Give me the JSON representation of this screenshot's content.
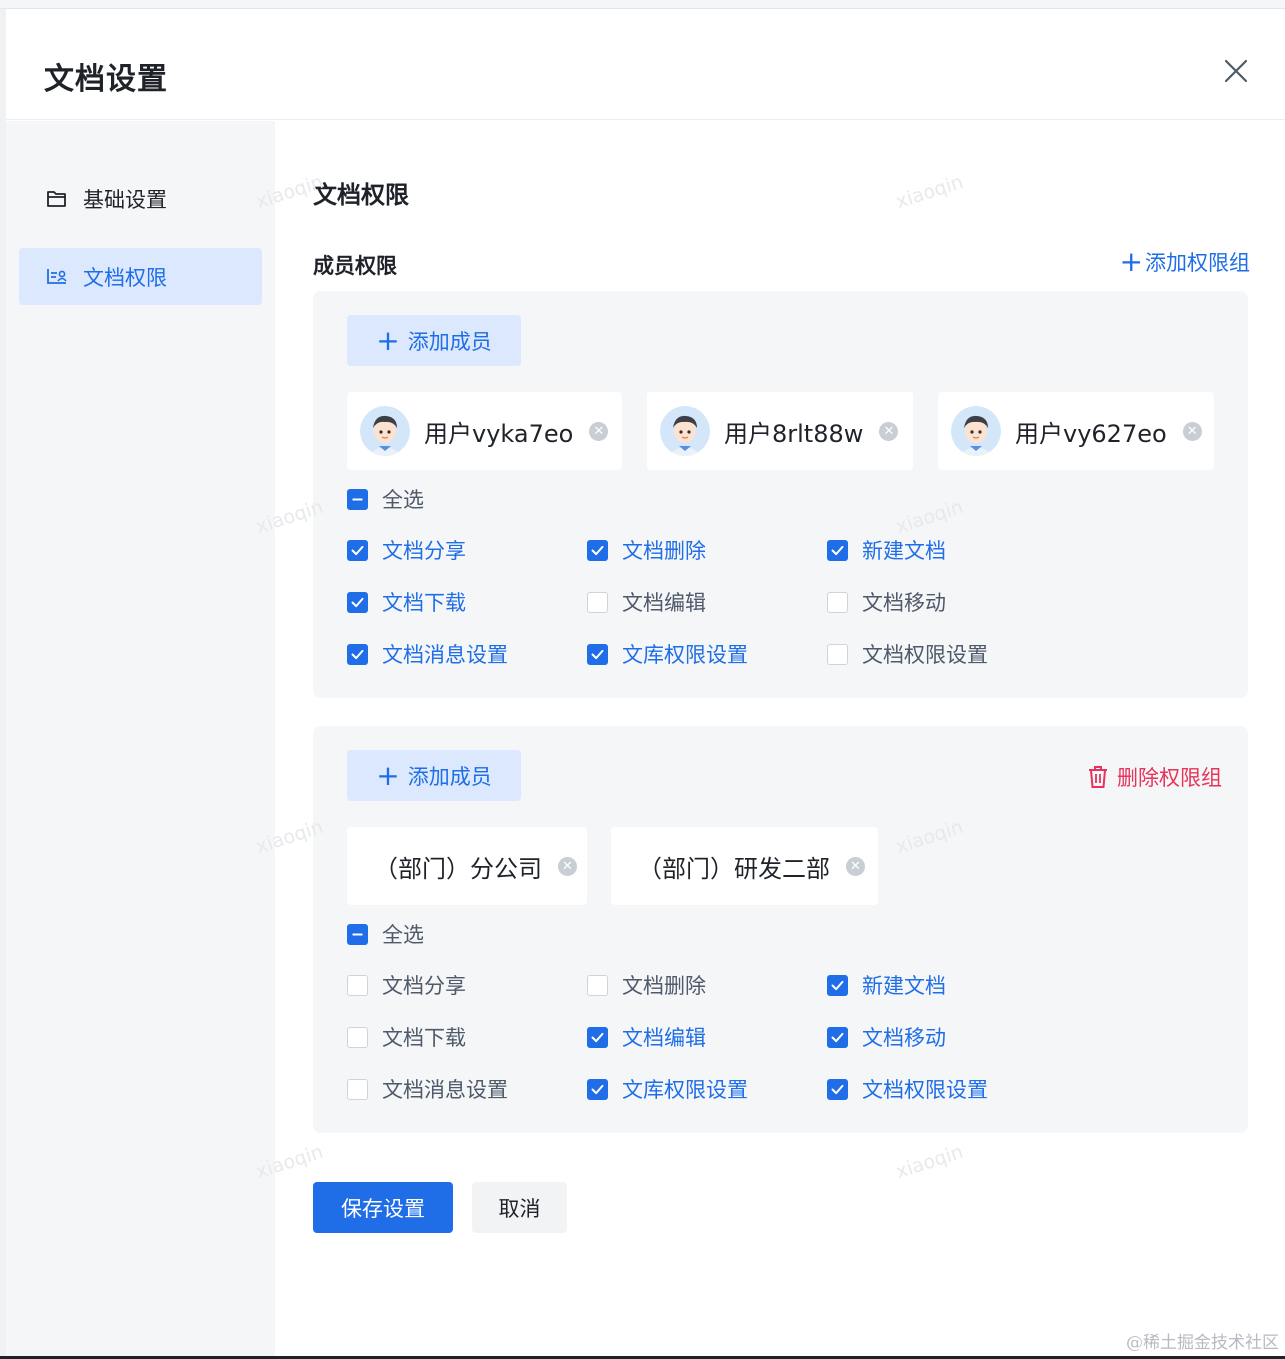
{
  "dialog": {
    "title": "文档设置",
    "close_icon": "close-icon"
  },
  "sidebar": {
    "items": [
      {
        "label": "基础设置",
        "icon": "folder-icon",
        "active": false
      },
      {
        "label": "文档权限",
        "icon": "permission-icon",
        "active": true
      }
    ]
  },
  "main": {
    "section_title": "文档权限",
    "sub_title": "成员权限",
    "add_group_label": "添加权限组",
    "groups": [
      {
        "add_member_label": "添加成员",
        "members": [
          {
            "name": "用户vyka7eo",
            "avatar": "user-avatar"
          },
          {
            "name": "用户8rlt88w",
            "avatar": "user-avatar"
          },
          {
            "name": "用户vy627eo",
            "avatar": "user-avatar"
          }
        ],
        "select_all_label": "全选",
        "select_all_state": "indeterminate",
        "permissions": [
          {
            "label": "文档分享",
            "checked": true
          },
          {
            "label": "文档删除",
            "checked": true
          },
          {
            "label": "新建文档",
            "checked": true
          },
          {
            "label": "文档下载",
            "checked": true
          },
          {
            "label": "文档编辑",
            "checked": false
          },
          {
            "label": "文档移动",
            "checked": false
          },
          {
            "label": "文档消息设置",
            "checked": true
          },
          {
            "label": "文库权限设置",
            "checked": true
          },
          {
            "label": "文档权限设置",
            "checked": false
          }
        ]
      },
      {
        "add_member_label": "添加成员",
        "delete_label": "删除权限组",
        "members": [
          {
            "name": "（部门）分公司"
          },
          {
            "name": "（部门）研发二部"
          }
        ],
        "select_all_label": "全选",
        "select_all_state": "indeterminate",
        "permissions": [
          {
            "label": "文档分享",
            "checked": false
          },
          {
            "label": "文档删除",
            "checked": false
          },
          {
            "label": "新建文档",
            "checked": true
          },
          {
            "label": "文档下载",
            "checked": false
          },
          {
            "label": "文档编辑",
            "checked": true
          },
          {
            "label": "文档移动",
            "checked": true
          },
          {
            "label": "文档消息设置",
            "checked": false
          },
          {
            "label": "文库权限设置",
            "checked": true
          },
          {
            "label": "文档权限设置",
            "checked": true
          }
        ]
      }
    ]
  },
  "footer": {
    "save_label": "保存设置",
    "cancel_label": "取消"
  },
  "watermark_text": "xiaoqin",
  "credit": "@稀土掘金技术社区",
  "colors": {
    "primary": "#1f6ee8",
    "danger": "#e8335a",
    "sidebar_bg": "#f5f6f7",
    "active_nav_bg": "#dbe8fd"
  }
}
